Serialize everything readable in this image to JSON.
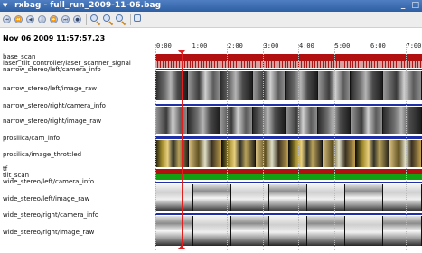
{
  "window": {
    "title": "rxbag - full_run_2009-11-06.bag"
  },
  "timeline": {
    "timestamp": "Nov 06 2009 11:57:57.23",
    "ticks": [
      "0:00",
      "1:00",
      "2:00",
      "3:00",
      "4:00",
      "5:00",
      "6:00",
      "7:00"
    ]
  },
  "topics": [
    "base_scan",
    "laser_tilt_controller/laser_scanner_signal",
    "narrow_stereo/left/camera_info",
    "narrow_stereo/left/image_raw",
    "narrow_stereo/right/camera_info",
    "narrow_stereo/right/image_raw",
    "prosilica/cam_info",
    "prosilica/image_throttled",
    "tf",
    "tilt_scan",
    "wide_stereo/left/camera_info",
    "wide_stereo/left/image_raw",
    "wide_stereo/right/camera_info",
    "wide_stereo/right/image_raw"
  ],
  "colors": {
    "red": "#b01010",
    "green": "#12a012",
    "blue": "#1f2fa6",
    "playhead": "#e02020"
  },
  "playhead_position_seconds": 40
}
